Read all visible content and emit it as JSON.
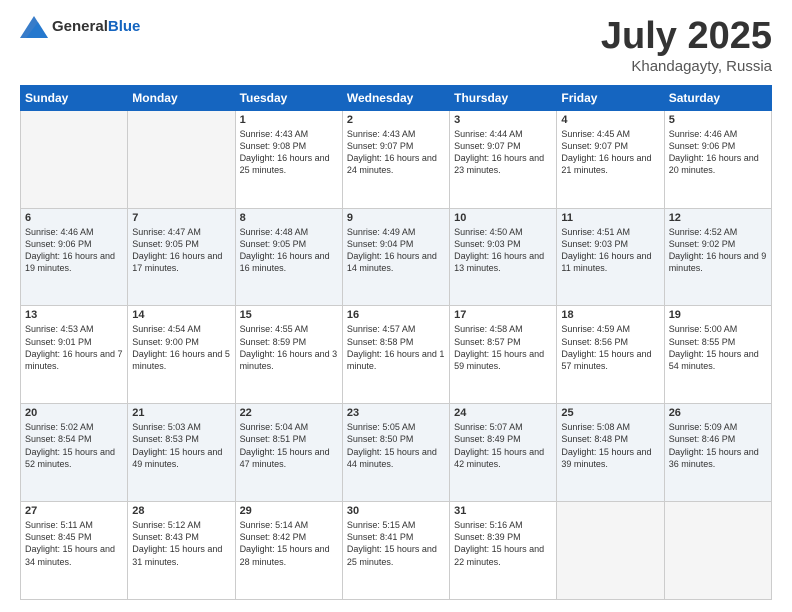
{
  "logo": {
    "general": "General",
    "blue": "Blue"
  },
  "title": {
    "month": "July 2025",
    "location": "Khandagayty, Russia"
  },
  "days_header": [
    "Sunday",
    "Monday",
    "Tuesday",
    "Wednesday",
    "Thursday",
    "Friday",
    "Saturday"
  ],
  "weeks": [
    [
      {
        "day": "",
        "info": ""
      },
      {
        "day": "",
        "info": ""
      },
      {
        "day": "1",
        "info": "Sunrise: 4:43 AM\nSunset: 9:08 PM\nDaylight: 16 hours and 25 minutes."
      },
      {
        "day": "2",
        "info": "Sunrise: 4:43 AM\nSunset: 9:07 PM\nDaylight: 16 hours and 24 minutes."
      },
      {
        "day": "3",
        "info": "Sunrise: 4:44 AM\nSunset: 9:07 PM\nDaylight: 16 hours and 23 minutes."
      },
      {
        "day": "4",
        "info": "Sunrise: 4:45 AM\nSunset: 9:07 PM\nDaylight: 16 hours and 21 minutes."
      },
      {
        "day": "5",
        "info": "Sunrise: 4:46 AM\nSunset: 9:06 PM\nDaylight: 16 hours and 20 minutes."
      }
    ],
    [
      {
        "day": "6",
        "info": "Sunrise: 4:46 AM\nSunset: 9:06 PM\nDaylight: 16 hours and 19 minutes."
      },
      {
        "day": "7",
        "info": "Sunrise: 4:47 AM\nSunset: 9:05 PM\nDaylight: 16 hours and 17 minutes."
      },
      {
        "day": "8",
        "info": "Sunrise: 4:48 AM\nSunset: 9:05 PM\nDaylight: 16 hours and 16 minutes."
      },
      {
        "day": "9",
        "info": "Sunrise: 4:49 AM\nSunset: 9:04 PM\nDaylight: 16 hours and 14 minutes."
      },
      {
        "day": "10",
        "info": "Sunrise: 4:50 AM\nSunset: 9:03 PM\nDaylight: 16 hours and 13 minutes."
      },
      {
        "day": "11",
        "info": "Sunrise: 4:51 AM\nSunset: 9:03 PM\nDaylight: 16 hours and 11 minutes."
      },
      {
        "day": "12",
        "info": "Sunrise: 4:52 AM\nSunset: 9:02 PM\nDaylight: 16 hours and 9 minutes."
      }
    ],
    [
      {
        "day": "13",
        "info": "Sunrise: 4:53 AM\nSunset: 9:01 PM\nDaylight: 16 hours and 7 minutes."
      },
      {
        "day": "14",
        "info": "Sunrise: 4:54 AM\nSunset: 9:00 PM\nDaylight: 16 hours and 5 minutes."
      },
      {
        "day": "15",
        "info": "Sunrise: 4:55 AM\nSunset: 8:59 PM\nDaylight: 16 hours and 3 minutes."
      },
      {
        "day": "16",
        "info": "Sunrise: 4:57 AM\nSunset: 8:58 PM\nDaylight: 16 hours and 1 minute."
      },
      {
        "day": "17",
        "info": "Sunrise: 4:58 AM\nSunset: 8:57 PM\nDaylight: 15 hours and 59 minutes."
      },
      {
        "day": "18",
        "info": "Sunrise: 4:59 AM\nSunset: 8:56 PM\nDaylight: 15 hours and 57 minutes."
      },
      {
        "day": "19",
        "info": "Sunrise: 5:00 AM\nSunset: 8:55 PM\nDaylight: 15 hours and 54 minutes."
      }
    ],
    [
      {
        "day": "20",
        "info": "Sunrise: 5:02 AM\nSunset: 8:54 PM\nDaylight: 15 hours and 52 minutes."
      },
      {
        "day": "21",
        "info": "Sunrise: 5:03 AM\nSunset: 8:53 PM\nDaylight: 15 hours and 49 minutes."
      },
      {
        "day": "22",
        "info": "Sunrise: 5:04 AM\nSunset: 8:51 PM\nDaylight: 15 hours and 47 minutes."
      },
      {
        "day": "23",
        "info": "Sunrise: 5:05 AM\nSunset: 8:50 PM\nDaylight: 15 hours and 44 minutes."
      },
      {
        "day": "24",
        "info": "Sunrise: 5:07 AM\nSunset: 8:49 PM\nDaylight: 15 hours and 42 minutes."
      },
      {
        "day": "25",
        "info": "Sunrise: 5:08 AM\nSunset: 8:48 PM\nDaylight: 15 hours and 39 minutes."
      },
      {
        "day": "26",
        "info": "Sunrise: 5:09 AM\nSunset: 8:46 PM\nDaylight: 15 hours and 36 minutes."
      }
    ],
    [
      {
        "day": "27",
        "info": "Sunrise: 5:11 AM\nSunset: 8:45 PM\nDaylight: 15 hours and 34 minutes."
      },
      {
        "day": "28",
        "info": "Sunrise: 5:12 AM\nSunset: 8:43 PM\nDaylight: 15 hours and 31 minutes."
      },
      {
        "day": "29",
        "info": "Sunrise: 5:14 AM\nSunset: 8:42 PM\nDaylight: 15 hours and 28 minutes."
      },
      {
        "day": "30",
        "info": "Sunrise: 5:15 AM\nSunset: 8:41 PM\nDaylight: 15 hours and 25 minutes."
      },
      {
        "day": "31",
        "info": "Sunrise: 5:16 AM\nSunset: 8:39 PM\nDaylight: 15 hours and 22 minutes."
      },
      {
        "day": "",
        "info": ""
      },
      {
        "day": "",
        "info": ""
      }
    ]
  ]
}
